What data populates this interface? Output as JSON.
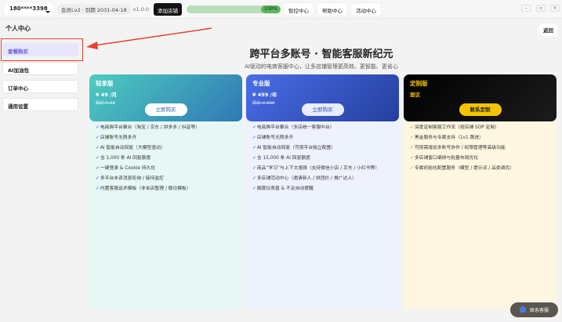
{
  "topbar": {
    "account": "180****3398",
    "member": "会员Lv2 · 到期 2031-04-18",
    "version": "v1.0.0",
    "add_shop": "添加店铺",
    "progress_label": "100%",
    "progress": 100,
    "nav": [
      "智控中心",
      "帮助中心",
      "活动中心"
    ],
    "window_controls": [
      "–",
      "▫",
      "×"
    ]
  },
  "sidebar": {
    "title": "个人中心",
    "items": [
      {
        "label": "套餐购买",
        "active": true
      },
      {
        "label": "AI加油包"
      },
      {
        "label": "订单中心"
      },
      {
        "label": "通用设置"
      }
    ]
  },
  "main": {
    "back": "返回",
    "headline": "跨平台多账号 · 智能客服新纪元",
    "subtitle": "AI驱动的电商客服中心，让多店铺管理更高效、更智能、更省心"
  },
  "plans": [
    {
      "name": "轻享版",
      "price": "¥ 49 /月",
      "original": "原价 ¥ 69",
      "button": "立即购买",
      "features": [
        "电商跨平台聚合（淘宝 / 京东 / 拼多多 / 抖音等）",
        "店铺账号无限多开",
        "AI 智能自动回复（大模型驱动）",
        "含 1,000 条 AI 回复额度",
        "一键登录 & Cookie 持久化",
        "多平台未读消息轮询 / 接待监控",
        "内置客服话术模板（非本店整理 / 稳住模板）"
      ]
    },
    {
      "name": "专业版",
      "price": "¥ 499 /年",
      "original": "原价 ¥ 999",
      "button": "立即购买",
      "features": [
        "电商跨平台聚合（多店统一客服中台）",
        "店铺账号无限多开",
        "AI 智能自动回复（可按平台独立配置）",
        "含 15,000 条 AI 回复额度",
        "商品“学习”与上下文增强（支持微信小店 / 京东 / 小红书等）",
        "多店铺活动中心（邀请新人 / 拼团价 / 推广达人）",
        "额度仪表盘 & 不足自动提醒"
      ]
    },
    {
      "name": "定制版",
      "price": "面议",
      "button": "联系定制",
      "features": [
        "深度定制客服工作流（按店铺 SOP 定制）",
        "黑金服务与专属支持（1v1 跟进）",
        "可按需增加多账号协作 / 权限管理等高级功能",
        "多店铺窗口编排与批量布局优化",
        "专属初始化配置服务（模型 / 提示词 / 品类调优）"
      ]
    }
  ],
  "fab": {
    "label": "联系客服"
  },
  "colors": {
    "highlight": "#e8402e",
    "light": "#3fc6bd",
    "pro": "#3653c9",
    "custom_accent": "#f5c400"
  }
}
